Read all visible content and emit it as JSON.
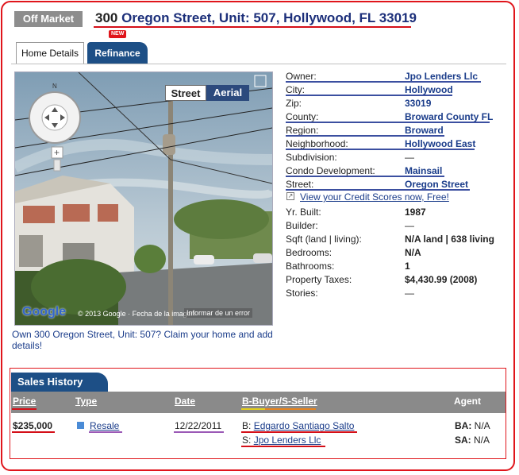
{
  "header": {
    "status_badge": "Off Market",
    "address_number": "300",
    "address_rest": "Oregon Street, Unit: 507, Hollywood, FL 33019",
    "new_badge": "NEW"
  },
  "tabs": [
    {
      "label": "Home Details",
      "active": true
    },
    {
      "label": "Refinance",
      "active": false
    }
  ],
  "map": {
    "street_btn": "Street",
    "aerial_btn": "Aerial",
    "google_logo": "Google",
    "copyright": "© 2013 Google · Fecha de la imagen",
    "report": "Informar de un error",
    "compass": "N"
  },
  "claim_text": "Own 300 Oregon Street, Unit: 507? Claim your home and add details!",
  "details": [
    {
      "label": "Owner:",
      "value": "Jpo Lenders Llc",
      "style": "link"
    },
    {
      "label": "City:",
      "value": "Hollywood",
      "style": "link"
    },
    {
      "label": "Zip:",
      "value": "33019",
      "style": "link"
    },
    {
      "label": "County:",
      "value": "Broward County FL",
      "style": "link"
    },
    {
      "label": "Region:",
      "value": "Broward",
      "style": "link"
    },
    {
      "label": "Neighborhood:",
      "value": "Hollywood East",
      "style": "link"
    },
    {
      "label": "Subdivision:",
      "value": "—",
      "style": "plain"
    },
    {
      "label": "Condo Development:",
      "value": "Mainsail",
      "style": "link"
    },
    {
      "label": "Street:",
      "value": "Oregon Street",
      "style": "link"
    }
  ],
  "credit_link": "View your Credit Scores now, Free!",
  "details2": [
    {
      "label": "Yr. Built:",
      "value": "1987"
    },
    {
      "label": "Builder:",
      "value": "—"
    },
    {
      "label": "Sqft (land | living):",
      "value": "N/A land | 638 living"
    },
    {
      "label": "Bedrooms:",
      "value": "N/A"
    },
    {
      "label": "Bathrooms:",
      "value": "1"
    },
    {
      "label": "Property Taxes:",
      "value": "$4,430.99 (2008)"
    },
    {
      "label": "Stories:",
      "value": "—"
    }
  ],
  "sales_history": {
    "title": "Sales History",
    "columns": [
      "Price",
      "Type",
      "Date",
      "B-Buyer/S-Seller",
      "Agent"
    ],
    "row": {
      "price": "$235,000",
      "type": "Resale",
      "date": "12/22/2011",
      "buyer_prefix": "B:",
      "buyer": "Edgardo Santiago Salto",
      "seller_prefix": "S:",
      "seller": "Jpo Lenders Llc",
      "ba_label": "BA:",
      "ba_value": "N/A",
      "sa_label": "SA:",
      "sa_value": "N/A"
    }
  },
  "colors": {
    "accent_red": "#e0151b",
    "tab_blue": "#1d4f86",
    "link_blue": "#1a3c8a",
    "header_gray": "#8a8a8a"
  }
}
